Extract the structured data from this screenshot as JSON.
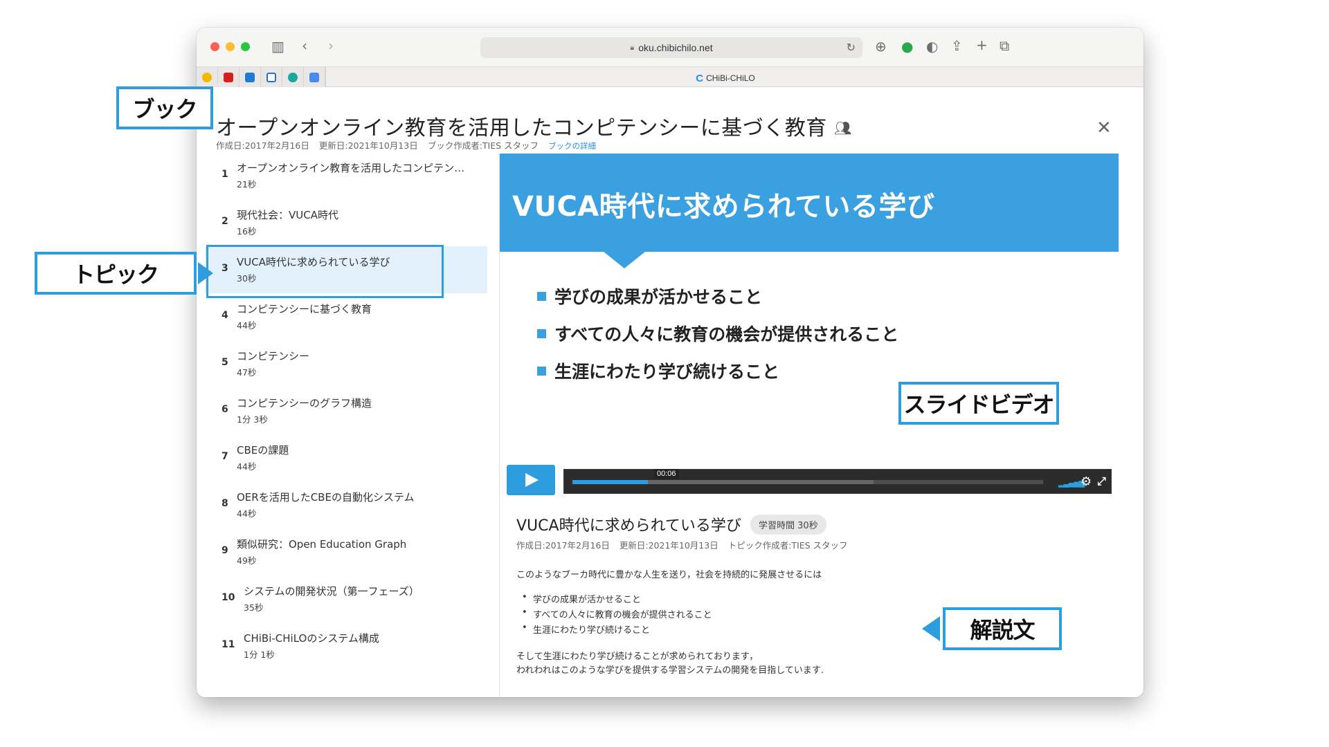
{
  "browser": {
    "url": "oku.chibichilo.net",
    "tab_title": "CHiBi-CHiLO"
  },
  "book": {
    "title": "オープンオンライン教育を活用したコンピテンシーに基づく教育",
    "created": "作成日:2017年2月16日",
    "updated": "更新日:2021年10月13日",
    "author": "ブック作成者:TIES スタッフ",
    "details_link": "ブックの詳細"
  },
  "topics": [
    {
      "num": "1",
      "title": "オープンオンライン教育を活用したコンピテン…",
      "duration": "21秒"
    },
    {
      "num": "2",
      "title": "現代社会：VUCA時代",
      "duration": "16秒"
    },
    {
      "num": "3",
      "title": "VUCA時代に求められている学び",
      "duration": "30秒"
    },
    {
      "num": "4",
      "title": "コンピテンシーに基づく教育",
      "duration": "44秒"
    },
    {
      "num": "5",
      "title": "コンピテンシー",
      "duration": "47秒"
    },
    {
      "num": "6",
      "title": "コンピテンシーのグラフ構造",
      "duration": "1分 3秒"
    },
    {
      "num": "7",
      "title": "CBEの課題",
      "duration": "44秒"
    },
    {
      "num": "8",
      "title": "OERを活用したCBEの自動化システム",
      "duration": "44秒"
    },
    {
      "num": "9",
      "title": "類似研究：Open Education Graph",
      "duration": "49秒"
    },
    {
      "num": "10",
      "title": "システムの開発状況（第一フェーズ）",
      "duration": "35秒"
    },
    {
      "num": "11",
      "title": "CHiBi-CHiLOのシステム構成",
      "duration": "1分 1秒"
    }
  ],
  "slide": {
    "title": "VUCA時代に求められている学び",
    "bullets": [
      "学びの成果が活かせること",
      "すべての人々に教育の機会が提供されること",
      "生涯にわたり学び続けること"
    ]
  },
  "player": {
    "time": "00:06",
    "progress": 0.16,
    "buffered": 0.64
  },
  "topic": {
    "title": "VUCA時代に求められている学び",
    "study_time": "学習時間 30秒",
    "created": "作成日:2017年2月16日",
    "updated": "更新日:2021年10月13日",
    "author": "トピック作成者:TIES スタッフ",
    "intro": "このようなブーカ時代に豊かな人生を送り，社会を持続的に発展させるには",
    "list": [
      "学びの成果が活かせること",
      "すべての人々に教育の機会が提供されること",
      "生涯にわたり学び続けること"
    ],
    "outro1": "そして生涯にわたり学び続けることが求められております，",
    "outro2": "われわれはこのような学びを提供する学習システムの開発を目指しています."
  },
  "callouts": {
    "book": "ブック",
    "topic": "トピック",
    "slide_video": "スライドビデオ",
    "description": "解説文"
  },
  "colors": {
    "accent": "#2d9de0",
    "slide_header": "#3ba0e0",
    "active_topic_bg": "#e3f1fc"
  }
}
